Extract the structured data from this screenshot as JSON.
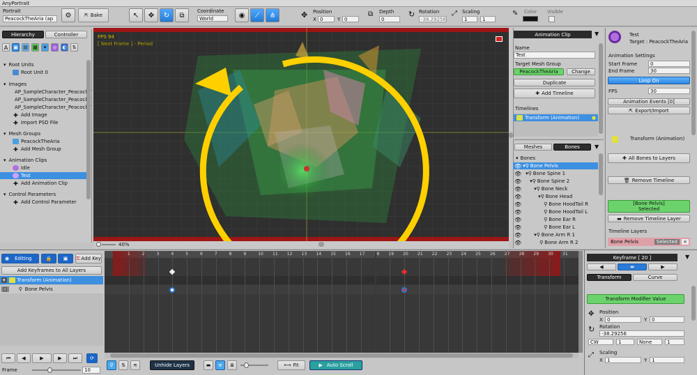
{
  "app": {
    "title": "AnyPortrait"
  },
  "toolbar": {
    "portrait_label": "Portrait",
    "portrait_value": "PeacockTheAria (ap",
    "bake": "Bake",
    "coordinate_label": "Coordinate",
    "coordinate_value": "World",
    "position_label": "Position",
    "x_label": "X",
    "x_value": "0",
    "y_label": "Y",
    "y_value": "0",
    "depth_label": "Depth",
    "depth_value": "0",
    "rotation_label": "Rotation",
    "rotation_value": "-38.29256",
    "scaling_label": "Scaling",
    "sx_value": "1",
    "sy_value": "1",
    "color_label": "Color",
    "visible_label": "Visible"
  },
  "left_panel": {
    "tabs": [
      "Hierarchy",
      "Controller"
    ],
    "sections": [
      {
        "title": "Root Units",
        "items": [
          {
            "label": "Root Unit 0",
            "selected": false
          }
        ]
      },
      {
        "title": "Images",
        "items": [
          {
            "label": "AP_SampleCharacter_PeacockT",
            "selected": false
          },
          {
            "label": "AP_SampleCharacter_PeacockT",
            "selected": false
          },
          {
            "label": "AP_SampleCharacter_PeacockT",
            "selected": false
          },
          {
            "label": "Add Image",
            "selected": false
          },
          {
            "label": "Import PSD File",
            "selected": false
          }
        ]
      },
      {
        "title": "Mesh Groups",
        "items": [
          {
            "label": "PeacockTheAria",
            "selected": false
          },
          {
            "label": "Add Mesh Group",
            "selected": false
          }
        ]
      },
      {
        "title": "Animation Clips",
        "items": [
          {
            "label": "Idle",
            "selected": false
          },
          {
            "label": "Test",
            "selected": true
          },
          {
            "label": "Add Animation Clip",
            "selected": false
          }
        ]
      },
      {
        "title": "Control Parameters",
        "items": [
          {
            "label": "Add Control Parameter",
            "selected": false
          }
        ]
      }
    ]
  },
  "viewport": {
    "fps": "FPS 94",
    "next_frame": "[ Next Frame ] - Period",
    "zoom": "40%"
  },
  "anim_clip": {
    "header": "Animation Clip",
    "name_label": "Name",
    "name_value": "Test",
    "target_label": "Target Mesh Group",
    "target_value": "PeacockTheAria",
    "change": "Change",
    "duplicate": "Duplicate",
    "add_timeline": "Add Timeline",
    "timelines_label": "Timelines",
    "timeline_item": "Transform (Animation)"
  },
  "bones_panel": {
    "tabs": [
      "Meshes",
      "Bones"
    ],
    "root": "Bones",
    "items": [
      "Bone Pelvis",
      "Bone Spine 1",
      "Bone Spine 2",
      "Bone Neck",
      "Bone Head",
      "Bone HoodTail R",
      "Bone HoodTail L",
      "Bone Ear R",
      "Bone Ear L",
      "Bone Arm R 1",
      "Bone Arm R 2"
    ]
  },
  "settings": {
    "name": "Test",
    "target": "Target : PeacockTheAria",
    "anim_settings": "Animation Settings",
    "start_label": "Start Frame",
    "start_value": "0",
    "end_label": "End Frame",
    "end_value": "30",
    "loop": "Loop On",
    "fps_label": "FPS",
    "fps_value": "30",
    "events": "Animation Events [0]",
    "export": "Export/Import",
    "timeline_name": "Transform (Animation)",
    "all_bones": "All Bones to Layers",
    "remove_timeline": "Remove Timeline",
    "pelvis_selected_1": "[Bone Pelvis]",
    "pelvis_selected_2": "Selected",
    "remove_layer": "Remove Timeline Layer",
    "layers_label": "Timeline Layers",
    "layer_item": "Bone Pelvis",
    "layer_selected": "Selected",
    "layer_x": "×"
  },
  "timeline": {
    "editing": "Editing",
    "add_key": "Add Key",
    "add_keyframes": "Add Keyframes to All Layers",
    "layer1": "Transform (Animation)",
    "layer2": "Bone Pelvis",
    "ticks": [
      "1",
      "2",
      "3",
      "4",
      "5",
      "6",
      "7",
      "8",
      "9",
      "10",
      "11",
      "12",
      "13",
      "14",
      "15",
      "16",
      "17",
      "18",
      "19",
      "20",
      "21",
      "22",
      "23",
      "24",
      "25",
      "26",
      "27",
      "28",
      "29",
      "30",
      "31"
    ],
    "key_frames": [
      4,
      20
    ],
    "unhide": "Unhide Layers",
    "fit": "Fit",
    "auto_scroll": "Auto Scroll",
    "frame_label": "Frame",
    "frame_value": "10"
  },
  "keyframe_panel": {
    "header": "Keyframe [ 20 ]",
    "tabs": [
      "Transform",
      "Curve"
    ],
    "modifier": "Transform Modifier Value",
    "position_label": "Position",
    "px": "0",
    "py": "0",
    "rotation_label": "Rotation",
    "rotation_value": "-38.29256",
    "cw": "CW",
    "cw_num": "1",
    "none": "None",
    "none_num": "1",
    "scaling_label": "Scaling",
    "sx": "1",
    "sy": "1"
  }
}
